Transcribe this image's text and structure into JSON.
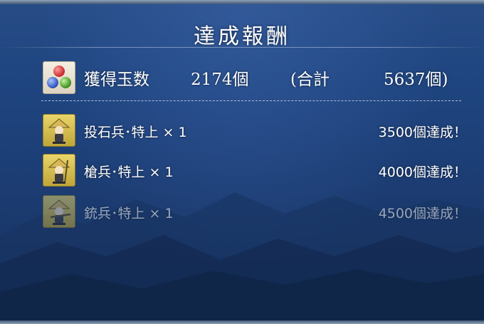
{
  "panel": {
    "title": "達成報酬"
  },
  "summary": {
    "icon": "colored-gems-icon",
    "label": "獲得玉数",
    "current": "2174個",
    "total_open": "(合計",
    "total": "5637個)"
  },
  "rewards": [
    {
      "icon": "soldier-icon",
      "label": "投石兵･特上 × 1",
      "goal": "3500個達成！",
      "achieved": true
    },
    {
      "icon": "soldier-icon",
      "label": "槍兵･特上 × 1",
      "goal": "4000個達成！",
      "achieved": true
    },
    {
      "icon": "soldier-icon",
      "label": "銃兵･特上 × 1",
      "goal": "4500個達成！",
      "achieved": false
    }
  ],
  "colors": {
    "background": "#1f4580",
    "text": "#ffffff",
    "icon_gold": "#e9d56a"
  }
}
